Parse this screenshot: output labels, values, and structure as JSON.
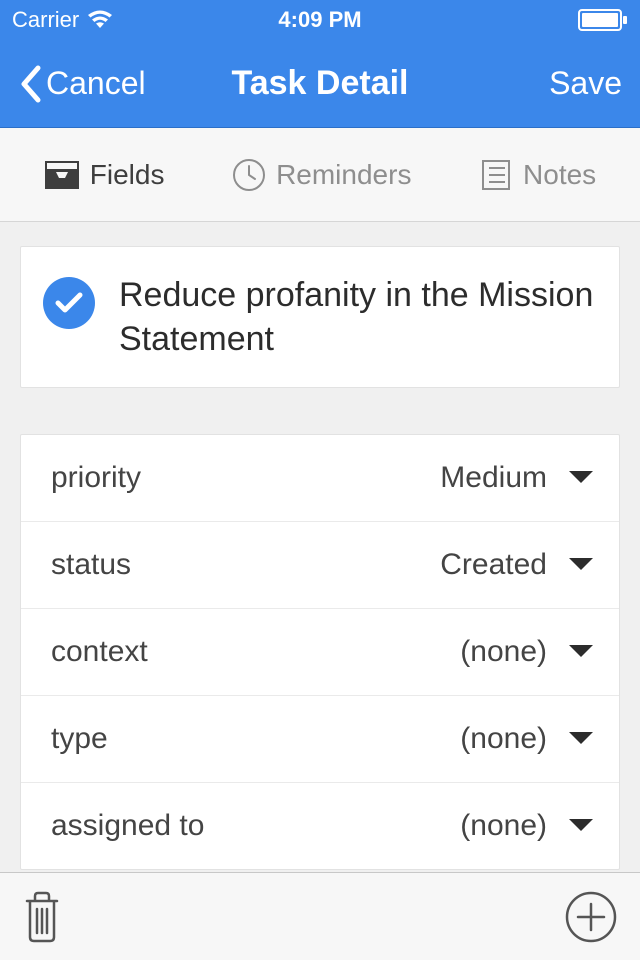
{
  "status_bar": {
    "carrier": "Carrier",
    "time": "4:09 PM"
  },
  "nav": {
    "cancel_label": "Cancel",
    "title": "Task Detail",
    "save_label": "Save"
  },
  "tabs": {
    "fields_label": "Fields",
    "reminders_label": "Reminders",
    "notes_label": "Notes"
  },
  "task": {
    "title": "Reduce profanity in the Mission Statement"
  },
  "fields": [
    {
      "label": "priority",
      "value": "Medium"
    },
    {
      "label": "status",
      "value": "Created"
    },
    {
      "label": "context",
      "value": "(none)"
    },
    {
      "label": "type",
      "value": "(none)"
    },
    {
      "label": "assigned to",
      "value": "(none)"
    }
  ]
}
